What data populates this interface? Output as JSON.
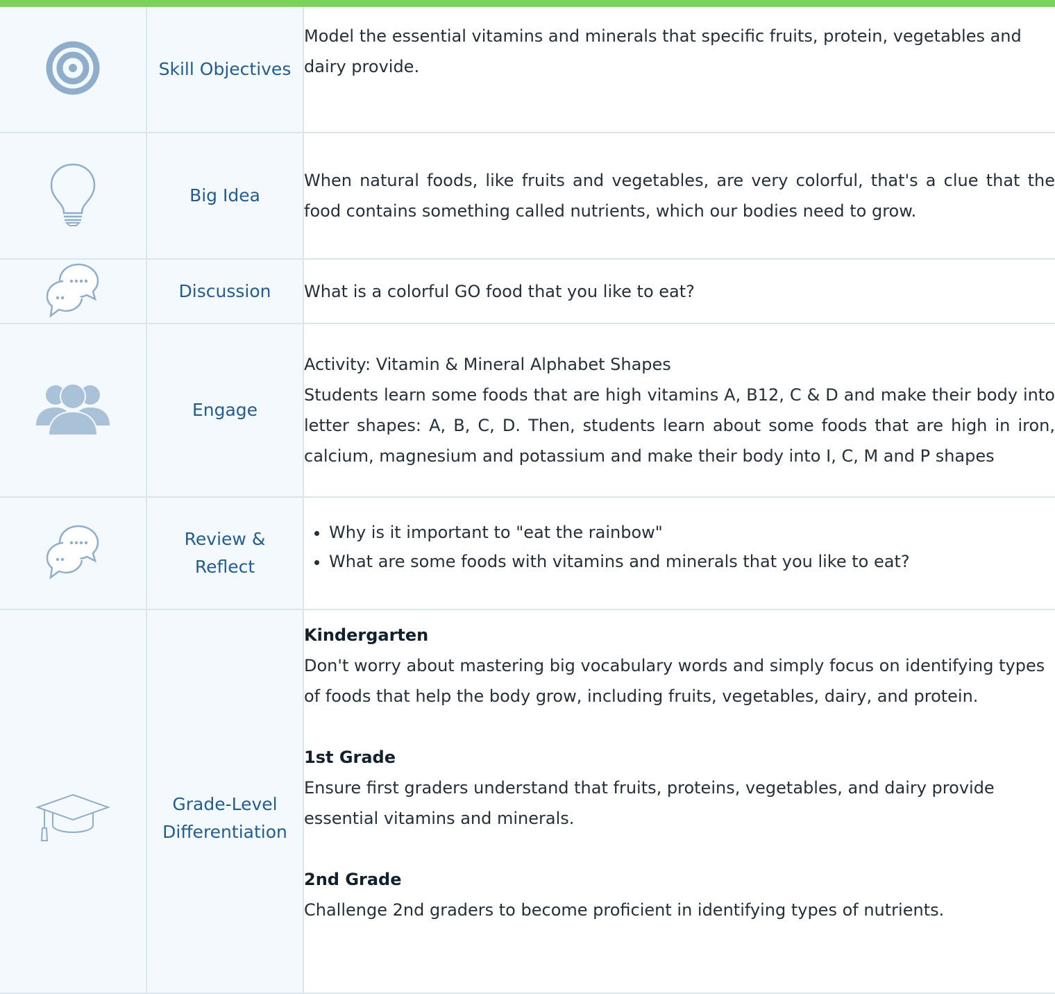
{
  "rows": [
    {
      "icon": "target-icon",
      "label": "Skill Objectives",
      "text": "Model the essential vitamins and minerals that specific fruits, protein, vegetables and dairy provide."
    },
    {
      "icon": "lightbulb-icon",
      "label": "Big Idea",
      "text": "When natural foods, like fruits and vegetables, are very colorful, that's a clue that the food contains something called nutrients, which our bodies need to grow."
    },
    {
      "icon": "chat-bubbles-icon",
      "label": "Discussion",
      "text": "What is a colorful GO food that you like to eat?"
    },
    {
      "icon": "group-icon",
      "label": "Engage",
      "activity": "Activity: Vitamin & Mineral Alphabet Shapes",
      "text": "Students learn some foods that are high vitamins A, B12, C & D and make their body into letter shapes: A, B, C, D. Then, students learn about some foods that are high in iron, calcium, magnesium and potassium and make their body into I, C, M and P shapes"
    },
    {
      "icon": "chat-bubbles-icon",
      "label": "Review & Reflect",
      "bullets": [
        "Why is it important to \"eat the rainbow\"",
        "What are some foods with vitamins and minerals that you like to eat?"
      ]
    },
    {
      "icon": "graduation-cap-icon",
      "label": "Grade-Level Differentiation",
      "grades": [
        {
          "title": "Kindergarten",
          "text": "Don't worry about mastering big vocabulary words and simply focus on identifying types of foods that help the body grow, including fruits, vegetables, dairy, and protein."
        },
        {
          "title": "1st Grade",
          "text": "Ensure first graders understand that fruits, proteins, vegetables, and dairy provide essential vitamins and minerals."
        },
        {
          "title": "2nd Grade",
          "text": "Challenge 2nd graders to become proficient in identifying types of nutrients."
        }
      ]
    }
  ],
  "colors": {
    "accent_bar": "#7bd35a",
    "label": "#215d93",
    "icon": "#8faecb",
    "cell_bg": "#f3f9fc",
    "border": "#d9e6ec"
  }
}
